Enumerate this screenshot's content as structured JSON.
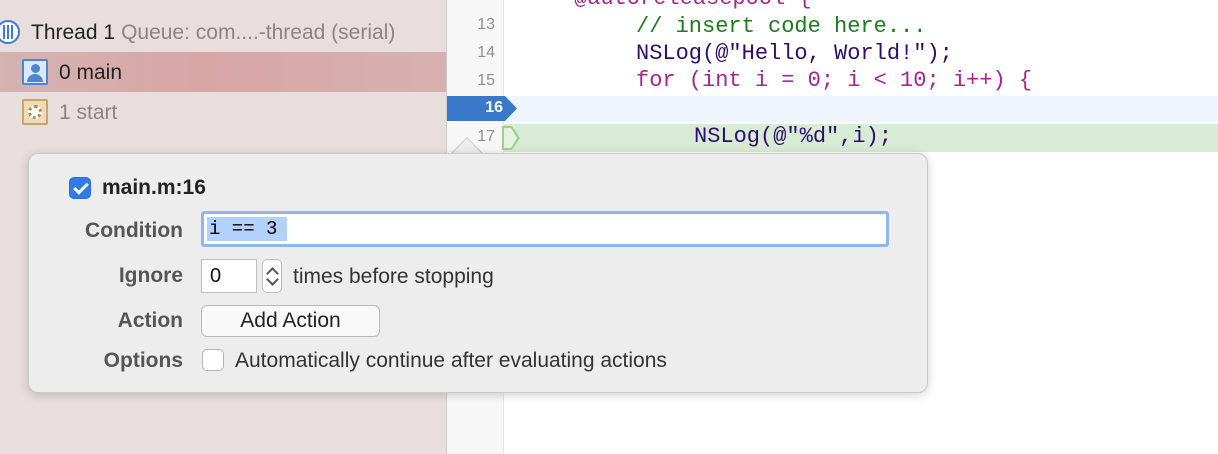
{
  "navigator": {
    "thread": {
      "label": "Thread 1",
      "queue": "Queue: com....-thread (serial)"
    },
    "frames": [
      {
        "label": "0 main"
      },
      {
        "label": "1 start"
      }
    ]
  },
  "editor": {
    "lines": [
      {
        "number": "13",
        "code": "// insert code here..."
      },
      {
        "number": "14",
        "code": "NSLog(@\"Hello, World!\");"
      },
      {
        "number": "15",
        "code": "for (int i = 0; i < 10; i++) {"
      },
      {
        "number": "16",
        "code": ""
      },
      {
        "number": "17",
        "code": "NSLog(@\"%d\",i);"
      }
    ],
    "partial_line": "@autoreleasepool {"
  },
  "breakpoint_popover": {
    "title": "main.m:16",
    "enabled": true,
    "condition_label": "Condition",
    "condition_value": "i == 3",
    "ignore_label": "Ignore",
    "ignore_value": "0",
    "ignore_suffix": "times before stopping",
    "action_label": "Action",
    "add_action_button": "Add Action",
    "options_label": "Options",
    "auto_continue_label": "Automatically continue after evaluating actions",
    "auto_continue_checked": false
  },
  "colors": {
    "breakpoint_blue": "#3a78c9",
    "pc_green": "#9fd18d",
    "checkbox_blue": "#2f7be8"
  }
}
